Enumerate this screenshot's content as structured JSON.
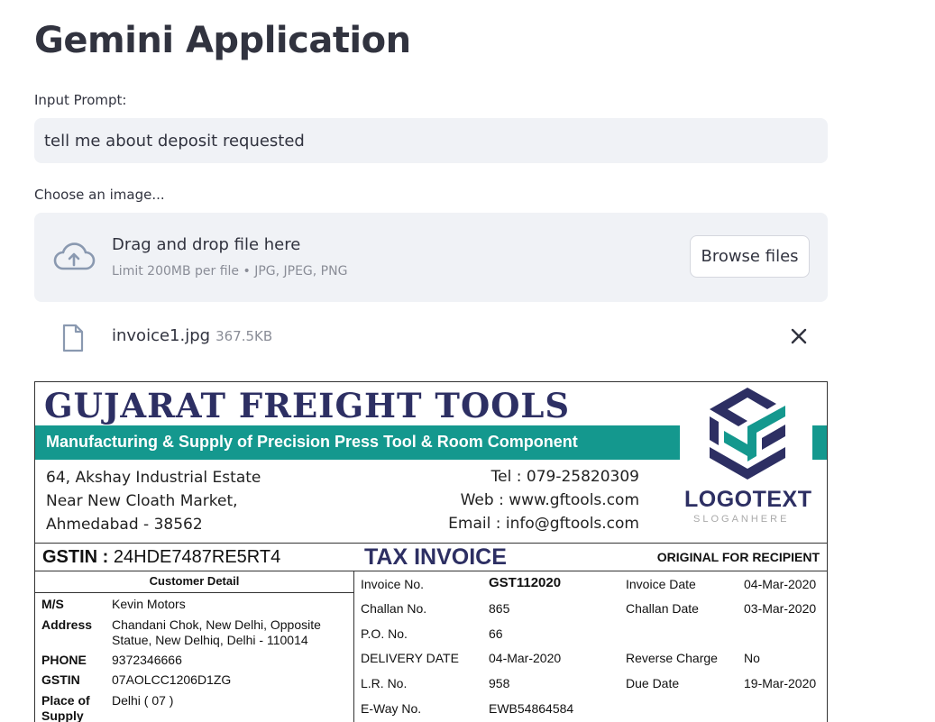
{
  "app": {
    "title": "Gemini Application"
  },
  "prompt": {
    "label": "Input Prompt:",
    "value": "tell me about deposit requested"
  },
  "uploader": {
    "label": "Choose an image...",
    "drag_text": "Drag and drop file here",
    "limit_text": "Limit 200MB per file • JPG, JPEG, PNG",
    "browse_label": "Browse files",
    "icon": "cloud-upload-icon"
  },
  "file": {
    "name": "invoice1.jpg",
    "size": "367.5KB",
    "icon": "file-icon"
  },
  "invoice": {
    "company": "GUJARAT FREIGHT TOOLS",
    "tagline": "Manufacturing & Supply of Precision Press Tool & Room Component",
    "address": [
      "64, Akshay Industrial Estate",
      "Near New Cloath Market,",
      "Ahmedabad - 38562"
    ],
    "contact": [
      "Tel : 079-25820309",
      "Web : www.gftools.com",
      "Email : info@gftools.com"
    ],
    "logo_text": "LOGOTEXT",
    "logo_slogan": "SLOGANHERE",
    "gstin_label": "GSTIN :",
    "gstin_value": "24HDE7487RE5RT4",
    "doc_title": "TAX INVOICE",
    "copy_label": "ORIGINAL FOR RECIPIENT",
    "customer_header": "Customer Detail",
    "customer": [
      {
        "k": "M/S",
        "v": "Kevin Motors"
      },
      {
        "k": "Address",
        "v": "Chandani Chok, New Delhi, Opposite Statue, New Delhiq, Delhi - 110014"
      },
      {
        "k": "PHONE",
        "v": "9372346666"
      },
      {
        "k": "GSTIN",
        "v": "07AOLCC1206D1ZG"
      },
      {
        "k": "Place of Supply",
        "v": "Delhi ( 07 )"
      }
    ],
    "details": [
      {
        "k": "Invoice No.",
        "v": "GST112020"
      },
      {
        "k": "Challan No.",
        "v": "865"
      },
      {
        "k": "P.O. No.",
        "v": "66"
      },
      {
        "k": "DELIVERY DATE",
        "v": "04-Mar-2020"
      },
      {
        "k": "L.R. No.",
        "v": "958"
      },
      {
        "k": "E-Way No.",
        "v": "EWB54864584"
      }
    ],
    "details_right": [
      {
        "k": "Invoice Date",
        "v": "04-Mar-2020"
      },
      {
        "k": "Challan Date",
        "v": "03-Mar-2020"
      },
      {
        "k": "Reverse Charge",
        "v": "No"
      },
      {
        "k": "Due Date",
        "v": "19-Mar-2020"
      }
    ],
    "colors": {
      "navy": "#2d2f63",
      "teal": "#14988e"
    }
  }
}
